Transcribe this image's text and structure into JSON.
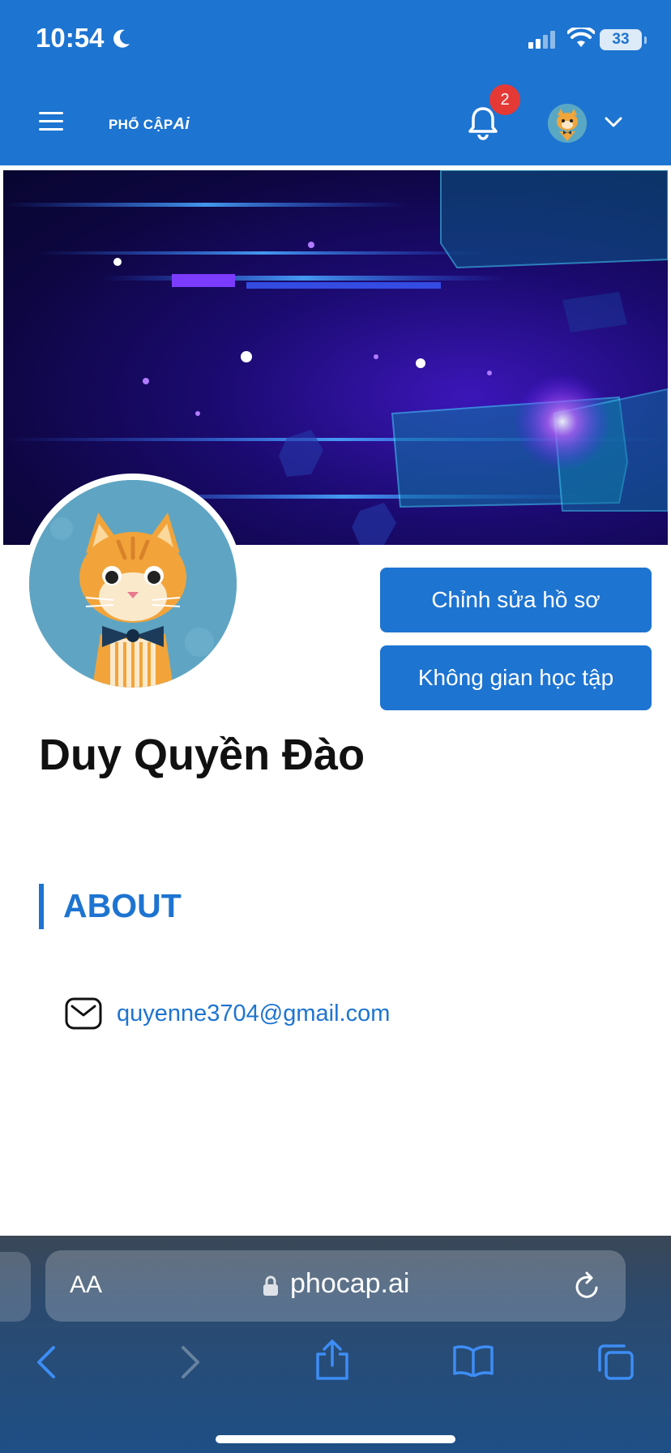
{
  "status_bar": {
    "time": "10:54",
    "battery": "33"
  },
  "header": {
    "logo_text": "PHỔ CẬP",
    "logo_ai": "Ai",
    "notification_count": "2"
  },
  "profile": {
    "name": "Duy Quyền Đào",
    "edit_button": "Chỉnh sửa hồ sơ",
    "workspace_button": "Không gian học tập"
  },
  "about": {
    "heading": "ABOUT",
    "email": "quyenne3704@gmail.com"
  },
  "browser": {
    "text_size_label": "AA",
    "url": "phocap.ai"
  },
  "colors": {
    "primary": "#1d74d1",
    "badge": "#e53935"
  }
}
